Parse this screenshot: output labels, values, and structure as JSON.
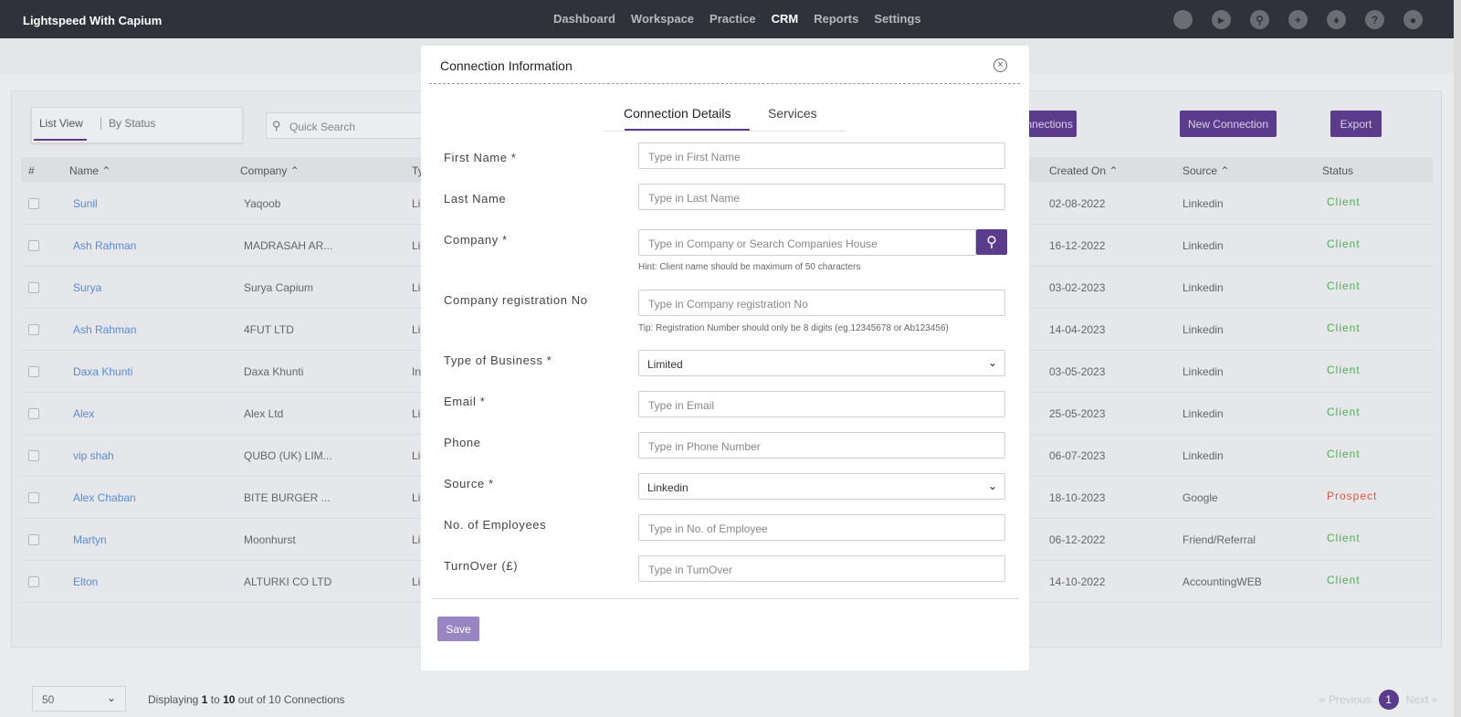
{
  "app": {
    "title": "Lightspeed With Capium"
  },
  "nav": {
    "items": [
      "Dashboard",
      "Workspace",
      "Practice",
      "CRM",
      "Reports",
      "Settings"
    ],
    "active": "CRM",
    "icons": [
      "status-icon",
      "megaphone-icon",
      "search-icon",
      "plus-icon",
      "tag-icon",
      "help-icon",
      "user-icon"
    ]
  },
  "toolbar": {
    "view_list": "List View",
    "view_status": "By Status",
    "search_placeholder": "Quick Search",
    "connections_btn": "Connections",
    "new_connection_btn": "New Connection",
    "export_btn": "Export"
  },
  "table": {
    "headers": {
      "num": "#",
      "name": "Name",
      "company": "Company",
      "type": "Ty",
      "created": "Created On",
      "source": "Source",
      "status": "Status"
    },
    "rows": [
      {
        "name": "Sunil",
        "company": "Yaqoob",
        "type": "Li",
        "created": "02-08-2022",
        "source": "Linkedin",
        "status": "Client"
      },
      {
        "name": "Ash Rahman",
        "company": "MADRASAH AR...",
        "type": "Li",
        "created": "16-12-2022",
        "source": "Linkedin",
        "status": "Client"
      },
      {
        "name": "Surya",
        "company": "Surya Capium",
        "type": "Li",
        "created": "03-02-2023",
        "source": "Linkedin",
        "status": "Client"
      },
      {
        "name": "Ash Rahman",
        "company": "4FUT LTD",
        "type": "Li",
        "created": "14-04-2023",
        "source": "Linkedin",
        "status": "Client"
      },
      {
        "name": "Daxa Khunti",
        "company": "Daxa Khunti",
        "type": "In",
        "created": "03-05-2023",
        "source": "Linkedin",
        "status": "Client"
      },
      {
        "name": "Alex",
        "company": "Alex Ltd",
        "type": "Li",
        "created": "25-05-2023",
        "source": "Linkedin",
        "status": "Client"
      },
      {
        "name": "vip shah",
        "company": "QUBO (UK) LIM...",
        "type": "Li",
        "created": "06-07-2023",
        "source": "Linkedin",
        "status": "Client"
      },
      {
        "name": "Alex Chaban",
        "company": "BITE BURGER ...",
        "type": "Li",
        "created": "18-10-2023",
        "source": "Google",
        "status": "Prospect"
      },
      {
        "name": "Martyn",
        "company": "Moonhurst",
        "type": "Li",
        "created": "06-12-2022",
        "source": "Friend/Referral",
        "status": "Client"
      },
      {
        "name": "Elton",
        "company": "ALTURKI CO LTD",
        "type": "Li",
        "created": "14-10-2022",
        "source": "AccountingWEB",
        "status": "Client"
      }
    ]
  },
  "footer": {
    "page_size": "50",
    "displaying_prefix": "Displaying",
    "from": "1",
    "to_word": "to",
    "to": "10",
    "suffix": "out of 10 Connections",
    "prev": "« Previous",
    "page": "1",
    "next": "Next »"
  },
  "modal": {
    "title": "Connection Information",
    "tabs": [
      "Connection Details",
      "Services"
    ],
    "fields": {
      "first_name": {
        "label": "First Name *",
        "placeholder": "Type in First Name"
      },
      "last_name": {
        "label": "Last Name",
        "placeholder": "Type in Last Name"
      },
      "company": {
        "label": "Company *",
        "placeholder": "Type in Company or Search Companies House",
        "hint": "Hint: Client name should be maximum of 50 characters"
      },
      "company_reg": {
        "label": "Company registration No",
        "placeholder": "Type in Company registration No",
        "hint": "Tip: Registration Number should only be 8 digits (eg.12345678 or Ab123456)"
      },
      "type_of_business": {
        "label": "Type of Business *",
        "value": "Limited"
      },
      "email": {
        "label": "Email *",
        "placeholder": "Type in Email"
      },
      "phone": {
        "label": "Phone",
        "placeholder": "Type in Phone Number"
      },
      "source": {
        "label": "Source *",
        "value": "Linkedin"
      },
      "employees": {
        "label": "No. of Employees",
        "placeholder": "Type in No. of Employee"
      },
      "turnover": {
        "label": "TurnOver (£)",
        "placeholder": "Type in TurnOver"
      }
    },
    "save": "Save"
  },
  "colors": {
    "accent": "#5b3b8c",
    "client": "#4caf50",
    "prospect": "#e5573f",
    "link": "#5b8bd8"
  }
}
